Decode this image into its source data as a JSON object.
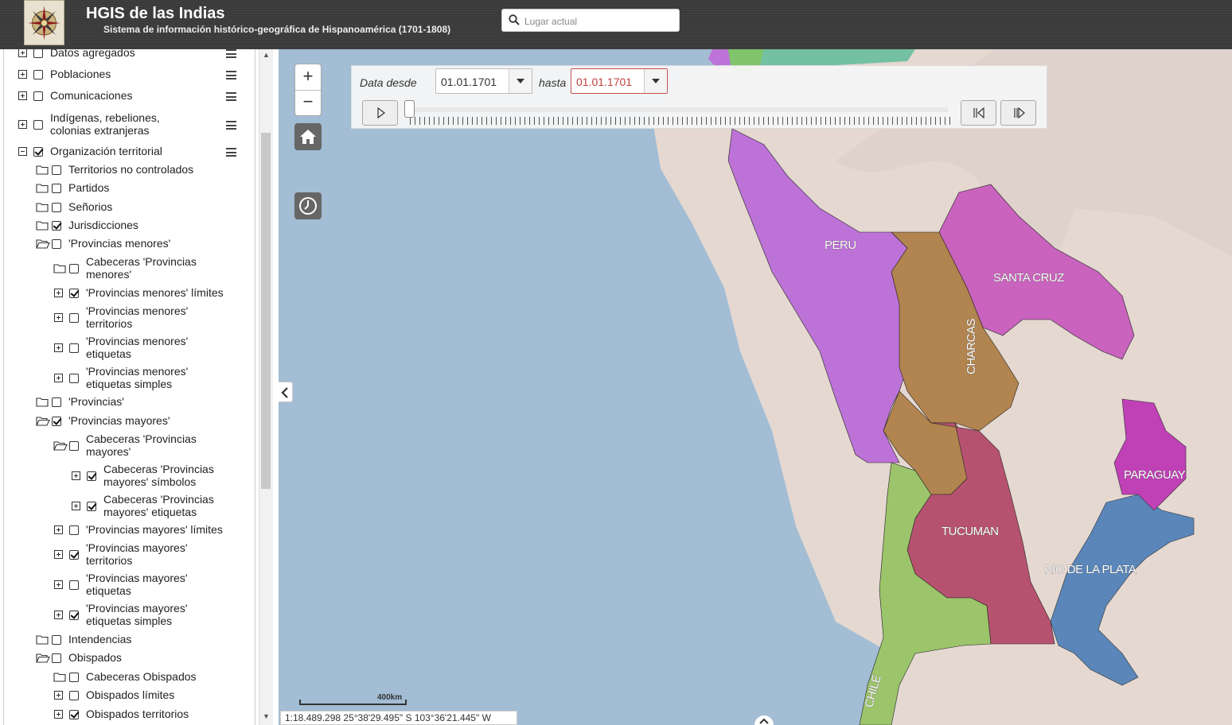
{
  "header": {
    "title": "HGIS de las Indias",
    "subtitle": "Sistema de información histórico-geográfica de Hispanoamérica (1701-1808)",
    "search_placeholder": "Lugar actual",
    "logo_icon": "compass-rose-icon"
  },
  "layers": [
    {
      "label": "Datos agregados",
      "checked": false,
      "expander": "plus",
      "menu": true
    },
    {
      "label": "Poblaciones",
      "checked": false,
      "expander": "plus",
      "menu": true
    },
    {
      "label": "Comunicaciones",
      "checked": false,
      "expander": "plus",
      "menu": true
    },
    {
      "label": "Indígenas, rebeliones, colonias extranjeras",
      "checked": false,
      "expander": "plus",
      "menu": true
    },
    {
      "label": "Organización territorial",
      "checked": true,
      "expander": "minus",
      "menu": true
    },
    {
      "label": "Territorios no controlados",
      "checked": false,
      "expander": "folder"
    },
    {
      "label": "Partidos",
      "checked": false,
      "expander": "folder"
    },
    {
      "label": "Señorios",
      "checked": false,
      "expander": "folder"
    },
    {
      "label": "Jurisdicciones",
      "checked": true,
      "expander": "folder"
    },
    {
      "label": "'Provincias menores'",
      "checked": false,
      "expander": "folder-open"
    },
    {
      "label": "Cabeceras 'Provincias menores'",
      "checked": false,
      "expander": "folder"
    },
    {
      "label": "'Provincias menores' límites",
      "checked": true,
      "expander": "plus"
    },
    {
      "label": "'Provincias menores' territorios",
      "checked": false,
      "expander": "plus"
    },
    {
      "label": "'Provincias menores' etiquetas",
      "checked": false,
      "expander": "plus"
    },
    {
      "label": "'Provincias menores' etiquetas simples",
      "checked": false,
      "expander": "plus"
    },
    {
      "label": "'Provincias'",
      "checked": false,
      "expander": "folder"
    },
    {
      "label": "'Provincias mayores'",
      "checked": true,
      "expander": "folder-open"
    },
    {
      "label": "Cabeceras 'Provincias mayores'",
      "checked": false,
      "expander": "folder-open"
    },
    {
      "label": "Cabeceras 'Provincias mayores' símbolos",
      "checked": true,
      "expander": "plus"
    },
    {
      "label": "Cabeceras 'Provincias mayores' etiquetas",
      "checked": true,
      "expander": "plus"
    },
    {
      "label": "'Provincias mayores' límites",
      "checked": false,
      "expander": "plus"
    },
    {
      "label": "'Provincias mayores' territorios",
      "checked": true,
      "expander": "plus"
    },
    {
      "label": "'Provincias mayores' etiquetas",
      "checked": false,
      "expander": "plus"
    },
    {
      "label": "'Provincias mayores' etiquetas simples",
      "checked": true,
      "expander": "plus"
    },
    {
      "label": "Intendencias",
      "checked": false,
      "expander": "folder"
    },
    {
      "label": "Obispados",
      "checked": false,
      "expander": "folder-open"
    },
    {
      "label": "Cabeceras Obispados",
      "checked": false,
      "expander": "folder"
    },
    {
      "label": "Obispados límites",
      "checked": false,
      "expander": "plus"
    },
    {
      "label": "Obispados territorios",
      "checked": true,
      "expander": "plus"
    }
  ],
  "time_filter": {
    "from_label": "Data desde",
    "from_value": "01.01.1701",
    "to_label": "hasta",
    "to_value": "01.01.1701",
    "slider_position": 0
  },
  "map": {
    "zoom_in": "+",
    "zoom_out": "−",
    "scale_label": "400km",
    "coordinates": "1:18.489.298   25°38'29.495\" S   103°36'21.445\" W",
    "regions": [
      {
        "name": "PERU",
        "color": "#bd72d8"
      },
      {
        "name": "SANTA CRUZ",
        "color": "#c963bd"
      },
      {
        "name": "CHARCAS",
        "color": "#b2844f"
      },
      {
        "name": "TUCUMAN",
        "color": "#b6526f"
      },
      {
        "name": "PARAGUAY",
        "color": "#c040b6"
      },
      {
        "name": "RIO DE LA PLATA",
        "color": "#5a86b9"
      },
      {
        "name": "CHILE",
        "color": "#9cc46b"
      }
    ]
  }
}
